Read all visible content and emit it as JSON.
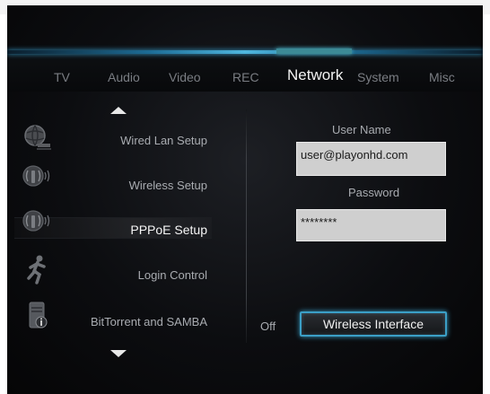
{
  "tabs": {
    "tv": "TV",
    "audio": "Audio",
    "video": "Video",
    "rec": "REC",
    "network": "Network",
    "system": "System",
    "misc": "Misc",
    "active": "Network"
  },
  "menu": {
    "items": [
      {
        "label": "Wired Lan Setup",
        "icon": "globe-network-icon"
      },
      {
        "label": "Wireless Setup",
        "icon": "wireless-signal-icon"
      },
      {
        "label": "PPPoE Setup",
        "icon": "wireless-signal-icon"
      },
      {
        "label": "Login Control",
        "icon": "running-person-icon"
      },
      {
        "label": "BitTorrent and SAMBA",
        "icon": "server-info-icon"
      }
    ],
    "selected": "PPPoE Setup"
  },
  "form": {
    "user_name_label": "User Name",
    "user_name_value": "user@playonhd.com",
    "password_label": "Password",
    "password_value": "********"
  },
  "status": {
    "off_label": "Off"
  },
  "wireless_button_label": "Wireless Interface",
  "colors": {
    "accent": "#3b9fc6",
    "tab_highlight": "#3c8a96",
    "background": "#0c0d10"
  }
}
